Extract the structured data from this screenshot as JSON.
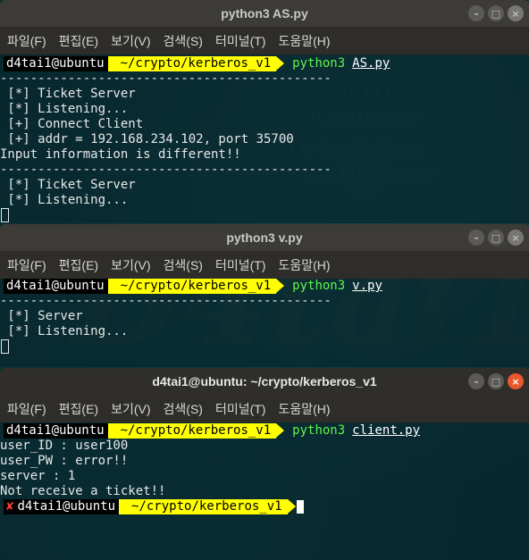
{
  "background": {
    "logo_text": "D4tai1",
    "binary_lines": [
      "001011101101110101",
      "1011011010100001",
      "1101011100101",
      "01011001010101"
    ]
  },
  "colors": {
    "prompt_dir_bg": "#ffff00",
    "prompt_user_bg": "#000000",
    "command_green": "#5ff54a",
    "error_x": "#ff3b3b",
    "close_button_active": "#e9572c"
  },
  "menu": [
    "파일(F)",
    "편집(E)",
    "보기(V)",
    "검색(S)",
    "터미널(T)",
    "도움말(H)"
  ],
  "window_buttons": {
    "minimize": "–",
    "maximize": "□",
    "close": "×"
  },
  "windows": {
    "as": {
      "title": "python3 AS.py",
      "prompt": {
        "user": "d4tai1@ubuntu",
        "dir": "~/crypto/kerberos_v1",
        "exe": "python3",
        "arg": "AS.py"
      },
      "lines": [
        "--------------------------------------------",
        " [*] Ticket Server",
        " [*] Listening...",
        " [+] Connect Client",
        " [+] addr = 192.168.234.102, port 35700",
        "Input information is different!!",
        "--------------------------------------------",
        " [*] Ticket Server",
        " [*] Listening..."
      ]
    },
    "v": {
      "title": "python3 v.py",
      "prompt": {
        "user": "d4tai1@ubuntu",
        "dir": "~/crypto/kerberos_v1",
        "exe": "python3",
        "arg": "v.py"
      },
      "lines": [
        "--------------------------------------------",
        " [*] Server",
        " [*] Listening..."
      ]
    },
    "client": {
      "title": "d4tai1@ubuntu: ~/crypto/kerberos_v1",
      "prompt": {
        "user": "d4tai1@ubuntu",
        "dir": "~/crypto/kerberos_v1",
        "exe": "python3",
        "arg": "client.py"
      },
      "lines": [
        "user_ID : user100",
        "user_PW : error!!",
        "server : 1",
        "Not receive a ticket!!"
      ],
      "final_prompt": {
        "error_mark": "✘",
        "user": "d4tai1@ubuntu",
        "dir": "~/crypto/kerberos_v1"
      }
    }
  }
}
